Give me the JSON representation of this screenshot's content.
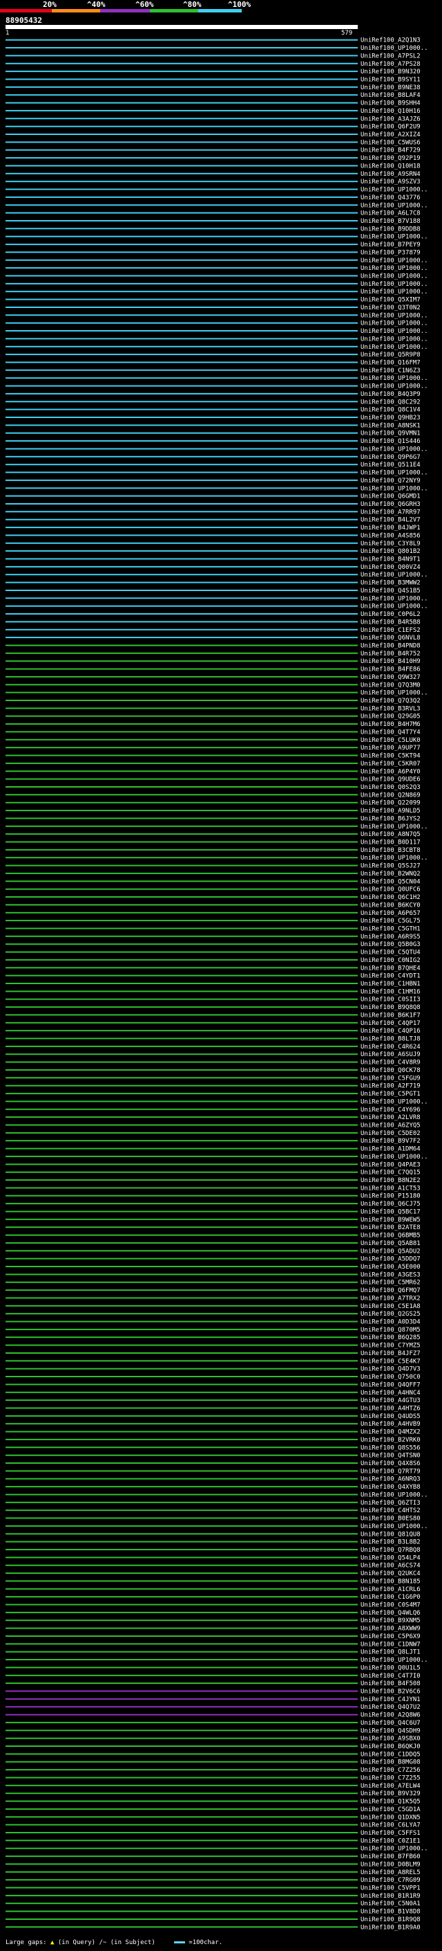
{
  "legend": {
    "labels": [
      "20%",
      "^40%",
      "^60%",
      "^80%",
      "^100%"
    ],
    "colors": [
      "#e8001c",
      "#ff8c1a",
      "#9030c0",
      "#30c030",
      "#40d0f0"
    ]
  },
  "query": {
    "id": "88905432",
    "start": "1",
    "end": "579"
  },
  "hits": {
    "names": [
      "UniRef100_A2Q1N3",
      "UniRef100_UP1000..",
      "UniRef100_A7PSL2",
      "UniRef100_A7PS28",
      "UniRef100_B9N320",
      "UniRef100_B9SY11",
      "UniRef100_B9NE38",
      "UniRef100_B8LAF4",
      "UniRef100_B9SHH4",
      "UniRef100_Q10H16",
      "UniRef100_A3AJZ6",
      "UniRef100_Q6F2U9",
      "UniRef100_A2XIZ4",
      "UniRef100_C5WUS6",
      "UniRef100_B4F729",
      "UniRef100_Q92P19",
      "UniRef100_Q10H18",
      "UniRef100_A9SRN4",
      "UniRef100_A9SZV3",
      "UniRef100_UP1000..",
      "UniRef100_Q43776",
      "UniRef100_UP1000..",
      "UniRef100_A6L7C8",
      "UniRef100_B7V188",
      "UniRef100_B9DDB8",
      "UniRef100_UP1000..",
      "UniRef100_B7PEY9",
      "UniRef100_P37879",
      "UniRef100_UP1000..",
      "UniRef100_UP1000..",
      "UniRef100_UP1000..",
      "UniRef100_UP1000..",
      "UniRef100_UP1000..",
      "UniRef100_Q5XIM7",
      "UniRef100_Q3T0N2",
      "UniRef100_UP1000..",
      "UniRef100_UP1000..",
      "UniRef100_UP1000..",
      "UniRef100_UP1000..",
      "UniRef100_UP1000..",
      "UniRef100_Q5R9P8",
      "UniRef100_Q16FM7",
      "UniRef100_C1N6Z3",
      "UniRef100_UP1000..",
      "UniRef100_UP1000..",
      "UniRef100_B4Q3P9",
      "UniRef100_Q8C292",
      "UniRef100_Q8C1V4",
      "UniRef100_Q9HB23",
      "UniRef100_A8NSK1",
      "UniRef100_Q9VMN1",
      "UniRef100_Q1S446",
      "UniRef100_UP1000..",
      "UniRef100_Q9P6G7",
      "UniRef100_Q511E4",
      "UniRef100_UP1000..",
      "UniRef100_Q72NY9",
      "UniRef100_UP1000..",
      "UniRef100_Q6GMD1",
      "UniRef100_Q6GRH3",
      "UniRef100_A7RR97",
      "UniRef100_B4L2V7",
      "UniRef100_B4JWP1",
      "UniRef100_A4S856",
      "UniRef100_C3Y8L9",
      "UniRef100_Q801B2",
      "UniRef100_B4N9T1",
      "UniRef100_Q00VZ4",
      "UniRef100_UP1000..",
      "UniRef100_B3MWW2",
      "UniRef100_Q4S1B5",
      "UniRef100_UP1000..",
      "UniRef100_UP1000..",
      "UniRef100_C0P6L2",
      "UniRef100_B4R5B8",
      "UniRef100_C1EFS2",
      "UniRef100_Q6NVL8",
      "UniRef100_B4PND8",
      "UniRef100_B4R752",
      "UniRef100_B410H9",
      "UniRef100_B4FE86",
      "UniRef100_Q9W327",
      "UniRef100_Q7Q3M0",
      "UniRef100_UP1000..",
      "UniRef100_Q7Q3Q2",
      "UniRef100_B3RVL3",
      "UniRef100_Q29G05",
      "UniRef100_B4H7M6",
      "UniRef100_Q4T7Y4",
      "UniRef100_C5LUK0",
      "UniRef100_A9UP77",
      "UniRef100_C5KT94",
      "UniRef100_C5KR07",
      "UniRef100_A6P4Y0",
      "UniRef100_Q9UDE6",
      "UniRef100_Q0S2Q3",
      "UniRef100_Q2N869",
      "UniRef100_Q22099",
      "UniRef100_A9NLD5",
      "UniRef100_B6JYS2",
      "UniRef100_UP1000..",
      "UniRef100_A8N7Q5",
      "UniRef100_B0D117",
      "UniRef100_B3CBT8",
      "UniRef100_UP1000..",
      "UniRef100_Q5SJ27",
      "UniRef100_B2WNQ2",
      "UniRef100_Q5CN04",
      "UniRef100_Q0UFC6",
      "UniRef100_Q6C1H2",
      "UniRef100_B6KCY0",
      "UniRef100_A6P657",
      "UniRef100_C5GL75",
      "UniRef100_C5GTH1",
      "UniRef100_A6R9S5",
      "UniRef100_Q5B0G3",
      "UniRef100_C5QTU4",
      "UniRef100_C0NIG2",
      "UniRef100_B7QHE4",
      "UniRef100_C4YDT1",
      "UniRef100_C1HBN1",
      "UniRef100_C1HM16",
      "UniRef100_C0SII3",
      "UniRef100_B9Q8Q8",
      "UniRef100_B6K1F7",
      "UniRef100_C4QP17",
      "UniRef100_C4QP16",
      "UniRef100_B8LTJ8",
      "UniRef100_C4R624",
      "UniRef100_A6SUJ9",
      "UniRef100_C4V8R9",
      "UniRef100_Q0CK78",
      "UniRef100_C5FGU9",
      "UniRef100_A2F719",
      "UniRef100_C5PGT1",
      "UniRef100_UP1000..",
      "UniRef100_C4Y696",
      "UniRef100_A2LVR8",
      "UniRef100_A6ZYQ5",
      "UniRef100_C5DE02",
      "UniRef100_B9V7F2",
      "UniRef100_A1DM64",
      "UniRef100_UP1000..",
      "UniRef100_Q4PAE3",
      "UniRef100_C7QQ15",
      "UniRef100_B8N2E2",
      "UniRef100_A1CT53",
      "UniRef100_P15180",
      "UniRef100_Q6CJ75",
      "UniRef100_Q5BC17",
      "UniRef100_B9WEW5",
      "UniRef100_B2ATE8",
      "UniRef100_Q6BMB5",
      "UniRef100_Q5AB81",
      "UniRef100_Q5ADU2",
      "UniRef100_A5DDQ7",
      "UniRef100_A5E000",
      "UniRef100_A3GES3",
      "UniRef100_C5MR62",
      "UniRef100_Q6FMQ7",
      "UniRef100_A7TRX2",
      "UniRef100_C5E1A8",
      "UniRef100_Q2GS25",
      "UniRef100_A0D3D4",
      "UniRef100_Q870M5",
      "UniRef100_B6Q285",
      "UniRef100_C7YMZ5",
      "UniRef100_B4JFZ7",
      "UniRef100_C5E4K7",
      "UniRef100_Q4D7V3",
      "UniRef100_Q750C0",
      "UniRef100_Q4QFF7",
      "UniRef100_A4HNC4",
      "UniRef100_A4GTU3",
      "UniRef100_A4HTZ6",
      "UniRef100_Q4UDS5",
      "UniRef100_A4HVB9",
      "UniRef100_Q4MZX2",
      "UniRef100_B2VRK0",
      "UniRef100_Q8S556",
      "UniRef100_Q4TSN0",
      "UniRef100_Q4X8S6",
      "UniRef100_Q7RT79",
      "UniRef100_A6NRQ3",
      "UniRef100_Q4XYB8",
      "UniRef100_UP1000..",
      "UniRef100_Q6ZTI3",
      "UniRef100_C4HTS2",
      "UniRef100_B0ES80",
      "UniRef100_UP1000..",
      "UniRef100_Q81QU8",
      "UniRef100_B3L8B2",
      "UniRef100_Q7RBQ8",
      "UniRef100_Q54LP4",
      "UniRef100_A6CS74",
      "UniRef100_Q2UKC4",
      "UniRef100_B8N185",
      "UniRef100_A1CRL6",
      "UniRef100_C1G6P0",
      "UniRef100_C0S4M7",
      "UniRef100_Q4WLQ6",
      "UniRef100_B9XNM5",
      "UniRef100_A8XWW9",
      "UniRef100_C5P6X9",
      "UniRef100_C1DNW7",
      "UniRef100_Q8LJT1",
      "UniRef100_UP1000..",
      "UniRef100_Q0U1L5",
      "UniRef100_C4T7I0",
      "UniRef100_B4F508",
      "UniRef100_B2V6C6",
      "UniRef100_C4JYN1",
      "UniRef100_Q4Q7U2",
      "UniRef100_A2Q8W6",
      "UniRef100_Q4C6U7",
      "UniRef100_Q4SDH9",
      "UniRef100_A9SBX0",
      "UniRef100_B6QKJ0",
      "UniRef100_C1DDQ5",
      "UniRef100_B8MG08",
      "UniRef100_C7Z256",
      "UniRef100_C7Z255",
      "UniRef100_A7ELW4",
      "UniRef100_B9V329",
      "UniRef100_Q1K5Q5",
      "UniRef100_C5GD1A",
      "UniRef100_Q1DXN5",
      "UniRef100_C6LYA7",
      "UniRef100_C5FFS1",
      "UniRef100_C0Z1E1",
      "UniRef100_UP1000..",
      "UniRef100_B7FB60",
      "UniRef100_D0BLM9",
      "UniRef100_A8REL5",
      "UniRef100_C7RG09",
      "UniRef100_C5VPP1",
      "UniRef100_B1R1R9",
      "UniRef100_C5N0A1",
      "UniRef100_B1V8D8",
      "UniRef100_B1R9Q8",
      "UniRef100_B1R9A0"
    ],
    "identity_bins": [
      4,
      4,
      4,
      4,
      4,
      4,
      4,
      4,
      4,
      4,
      4,
      4,
      4,
      4,
      4,
      4,
      4,
      4,
      4,
      4,
      4,
      4,
      4,
      4,
      4,
      4,
      4,
      4,
      4,
      4,
      4,
      4,
      4,
      4,
      4,
      4,
      4,
      4,
      4,
      4,
      4,
      4,
      4,
      4,
      4,
      4,
      4,
      4,
      4,
      4,
      4,
      4,
      4,
      4,
      4,
      4,
      4,
      4,
      4,
      4,
      4,
      4,
      4,
      4,
      4,
      4,
      4,
      4,
      4,
      4,
      4,
      4,
      4,
      4,
      4,
      4,
      4,
      3,
      3,
      3,
      3,
      3,
      3,
      3,
      3,
      3,
      3,
      3,
      3,
      3,
      3,
      3,
      3,
      3,
      3,
      3,
      3,
      3,
      3,
      3,
      3,
      3,
      3,
      3,
      3,
      3,
      3,
      3,
      3,
      3,
      3,
      3,
      3,
      3,
      3,
      3,
      3,
      3,
      3,
      3,
      3,
      3,
      3,
      3,
      3,
      3,
      3,
      3,
      3,
      3,
      3,
      3,
      3,
      3,
      3,
      3,
      3,
      3,
      3,
      3,
      3,
      3,
      3,
      3,
      3,
      3,
      3,
      3,
      3,
      3,
      3,
      3,
      3,
      3,
      3,
      3,
      3,
      3,
      3,
      3,
      3,
      3,
      3,
      3,
      3,
      3,
      3,
      3,
      3,
      3,
      3,
      3,
      3,
      3,
      3,
      3,
      3,
      3,
      3,
      3,
      3,
      3,
      3,
      3,
      3,
      3,
      3,
      3,
      3,
      3,
      3,
      3,
      3,
      3,
      3,
      3,
      3,
      3,
      3,
      3,
      3,
      3,
      3,
      3,
      3,
      3,
      3,
      3,
      3,
      3,
      2,
      2,
      2,
      2,
      3,
      3,
      3,
      3,
      3,
      3,
      3,
      3,
      3,
      3,
      3,
      3,
      3,
      3,
      3,
      3,
      3,
      3,
      3,
      3,
      3,
      3,
      3,
      3,
      3,
      3,
      3,
      3,
      3,
      3,
      3,
      3,
      3,
      3,
      3,
      3,
      3,
      3,
      3,
      3,
      4,
      3,
      3,
      3,
      3,
      3,
      3,
      3,
      3,
      3,
      3,
      4,
      4,
      3,
      3,
      3,
      3,
      3,
      3,
      3,
      3,
      3,
      3,
      3,
      3,
      3,
      3,
      3,
      3,
      3
    ]
  },
  "footer": {
    "large_gaps_label": "Large gaps:",
    "in_query_label": "(in Query)",
    "in_subject_label": "/~ (in Subject)",
    "scale_label": "=100char."
  }
}
